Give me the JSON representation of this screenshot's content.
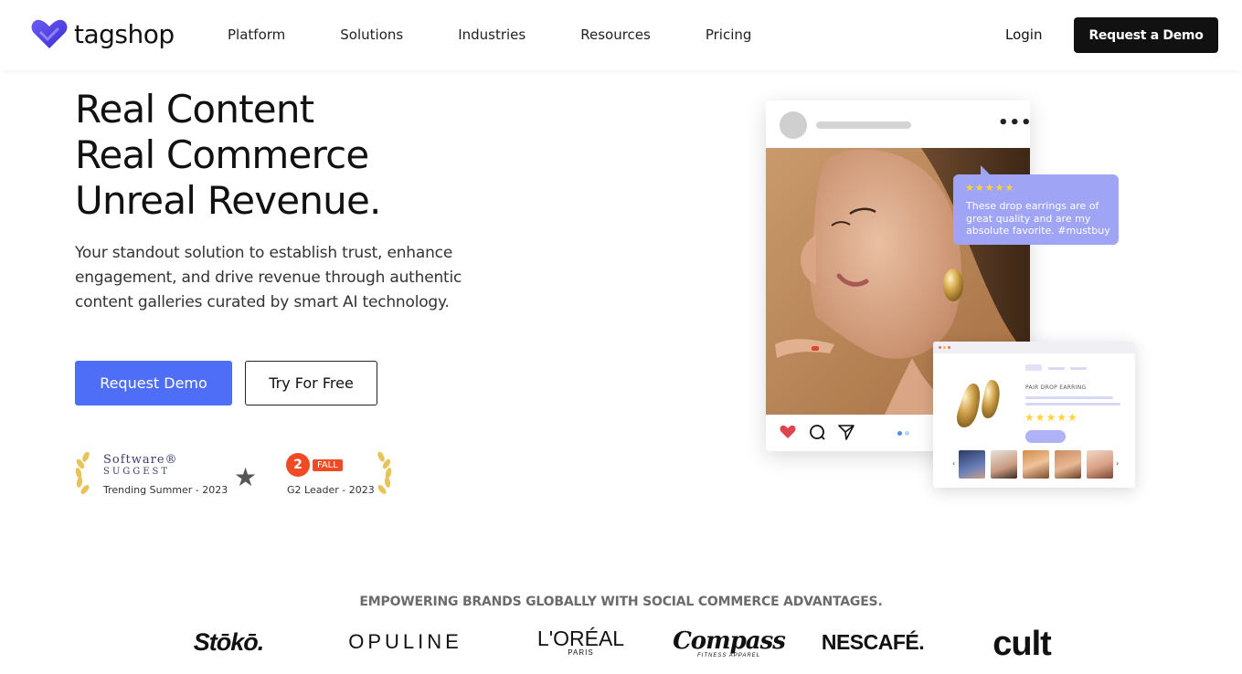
{
  "nav": {
    "logo_text": "tagshop",
    "links": [
      "Platform",
      "Solutions",
      "Industries",
      "Resources",
      "Pricing"
    ],
    "login": "Login",
    "cta": "Request a Demo"
  },
  "hero": {
    "title_lines": [
      "Real Content",
      "Real Commerce",
      "Unreal Revenue."
    ],
    "subtitle": "Your standout solution to establish trust, enhance engagement, and drive revenue through authentic content galleries curated by smart AI technology.",
    "primary_button": "Request Demo",
    "secondary_button": "Try For Free"
  },
  "awards": {
    "software_suggest": {
      "logo_line1": "Software®",
      "logo_line2": "SUGGEST",
      "caption": "Trending Summer - 2023"
    },
    "g2": {
      "badge": "FALL",
      "caption": "G2 Leader - 2023",
      "mark": "2"
    }
  },
  "review": {
    "stars": "★★★★★",
    "text": "These drop earrings are of great quality and are my absolute favorite. #mustbuy"
  },
  "product": {
    "name": "PAIR DROP EARRING",
    "stars": "★★★★★"
  },
  "brands": {
    "title": "EMPOWERING BRANDS GLOBALLY WITH SOCIAL COMMERCE ADVANTAGES.",
    "items": [
      "Stōkō.",
      "OPULINE",
      "L'ORÉAL",
      "PARIS",
      "Compass",
      "FITNESS APPAREL",
      "NESCAFÉ.",
      "cult"
    ]
  },
  "colors": {
    "accent": "#4f6ef7",
    "bubble": "#9fa4f5",
    "star": "#ffd23c",
    "g2": "#ef4a24"
  }
}
